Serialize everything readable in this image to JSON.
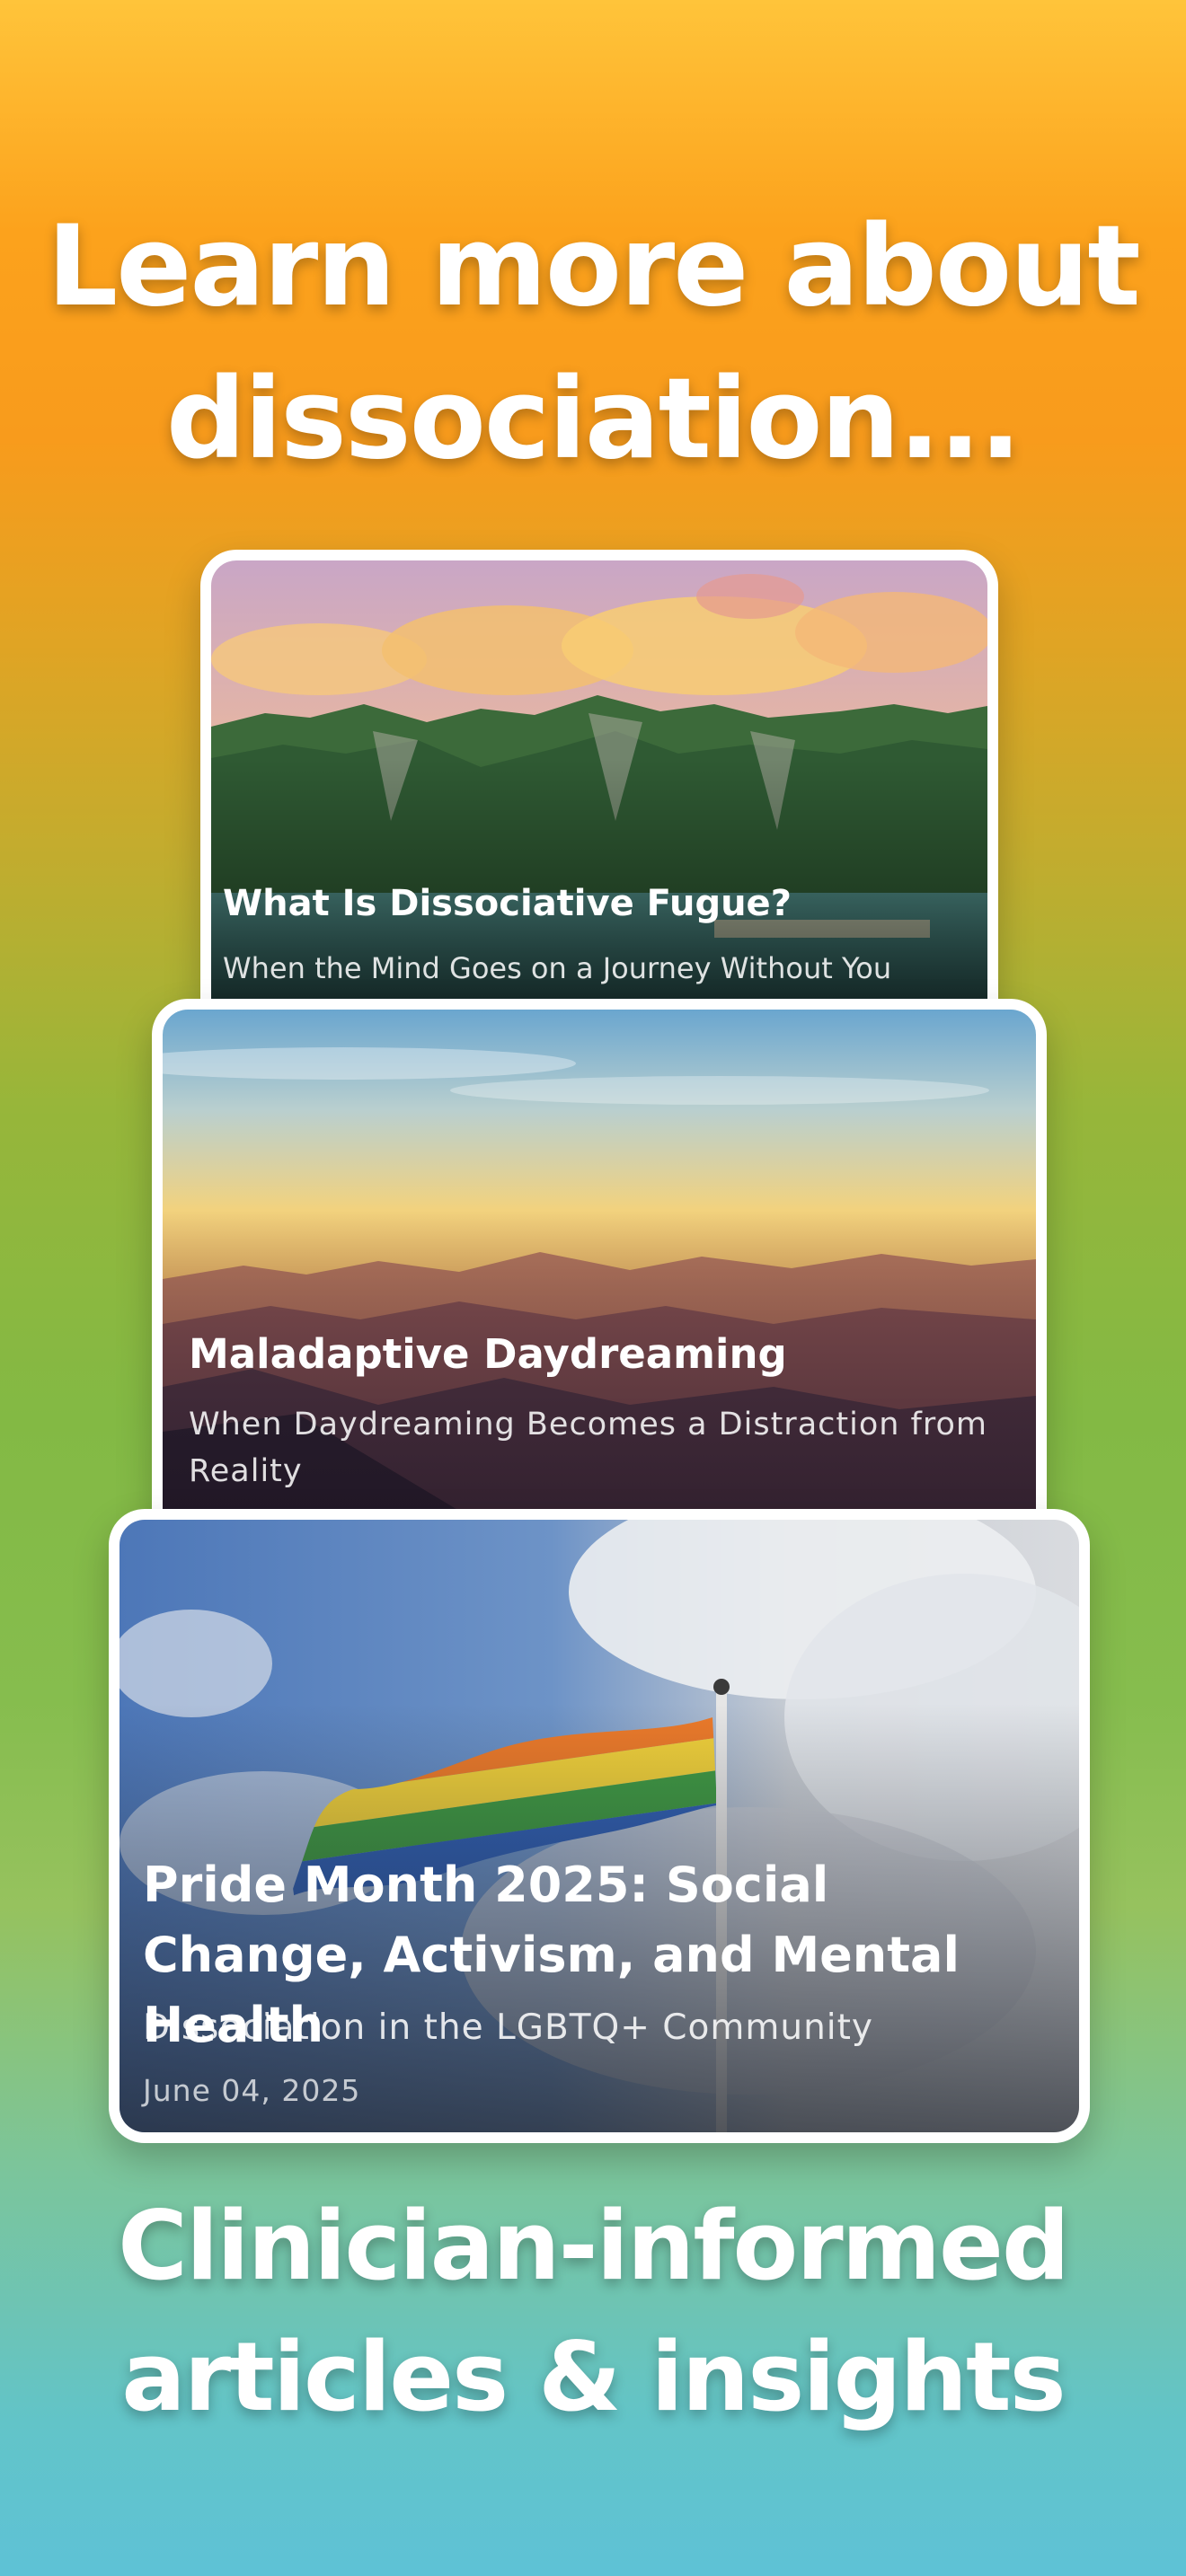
{
  "headline_top": [
    "Learn more about",
    "dissociation..."
  ],
  "headline_bottom": [
    "Clinician-informed",
    "articles & insights"
  ],
  "articles": [
    {
      "title": "What Is Dissociative Fugue?",
      "subtitle": "When the Mind Goes on a Journey Without You",
      "image": "tropical-island-mountains-photo"
    },
    {
      "title": "Maladaptive Daydreaming",
      "subtitle": "When Daydreaming Becomes a Distraction from Reality",
      "image": "misty-mountain-sunrise-photo"
    },
    {
      "title": "Pride Month 2025: Social Change, Activism, and Mental Health",
      "subtitle": "Dissociation in the LGBTQ+ Community",
      "date": "June 04, 2025",
      "image": "rainbow-pride-flag-photo"
    }
  ],
  "colors": {
    "background_top": "#ffc43a",
    "background_middle": "#83b944",
    "background_bottom": "#5ec2d6",
    "card_border": "#ffffff",
    "text": "#ffffff"
  }
}
